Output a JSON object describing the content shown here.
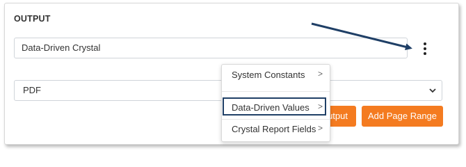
{
  "output": {
    "section_title": "OUTPUT",
    "text_field_value": "Data-Driven Crystal",
    "format_select_value": "PDF"
  },
  "buttons": {
    "output_label": "utput",
    "add_page_range_label": "Add Page Range"
  },
  "menu": {
    "items": [
      {
        "label": "System Constants",
        "chevron": ">"
      },
      {
        "label": "Data-Driven Values",
        "chevron": ">"
      },
      {
        "label": "Crystal Report Fields",
        "chevron": ">"
      }
    ]
  },
  "icons": {
    "kebab": "more-vertical-icon",
    "select_caret": "chevron-down-icon",
    "annotation_arrow": "arrow-icon"
  },
  "colors": {
    "accent_button": "#f47b20",
    "annotation": "#1f3f66"
  }
}
